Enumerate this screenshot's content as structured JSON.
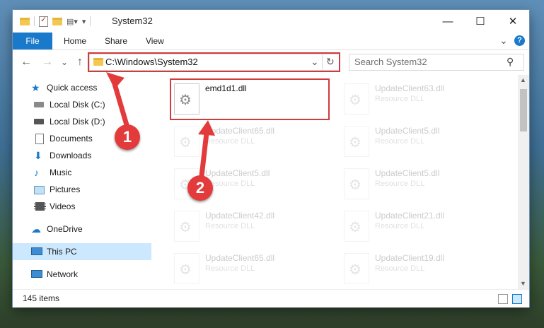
{
  "window": {
    "title": "System32",
    "controls": {
      "minimize": "—",
      "maximize": "☐",
      "close": "✕"
    }
  },
  "ribbon": {
    "tabs": [
      "File",
      "Home",
      "Share",
      "View"
    ],
    "help": "?",
    "expand_glyph": "⌄"
  },
  "address_bar": {
    "path": "C:\\Windows\\System32",
    "dropdown_glyph": "⌄",
    "refresh_glyph": "↻"
  },
  "search": {
    "placeholder": "Search System32",
    "icon": "search-icon"
  },
  "nav_buttons": {
    "back": "←",
    "forward": "→",
    "recent": "⌄",
    "up": "↑"
  },
  "nav_pane": {
    "items": [
      {
        "label": "Quick access",
        "icon": "star-icon",
        "pinned": false
      },
      {
        "label": "Local Disk (C:)",
        "icon": "drive-icon",
        "pinned": true
      },
      {
        "label": "Local Disk (D:)",
        "icon": "drive-icon",
        "pinned": true
      },
      {
        "label": "Documents",
        "icon": "documents-icon",
        "pinned": true
      },
      {
        "label": "Downloads",
        "icon": "download-icon",
        "pinned": true
      },
      {
        "label": "Music",
        "icon": "music-icon",
        "pinned": true
      },
      {
        "label": "Pictures",
        "icon": "pictures-icon",
        "pinned": true
      },
      {
        "label": "Videos",
        "icon": "videos-icon",
        "pinned": true
      },
      {
        "label": "OneDrive",
        "icon": "cloud-icon",
        "pinned": false
      },
      {
        "label": "This PC",
        "icon": "pc-icon",
        "pinned": false,
        "selected": true
      },
      {
        "label": "Network",
        "icon": "network-icon",
        "pinned": false
      }
    ],
    "pin_glyph": "📌"
  },
  "files": [
    {
      "name": "emd1d1.dll",
      "type": "",
      "highlighted": true
    },
    {
      "name": "UpdateClient63.dll",
      "type": "Resource DLL"
    },
    {
      "name": "UpdateClient65.dll",
      "type": "Resource DLL"
    },
    {
      "name": "UpdateClient5.dll",
      "type": "Resource DLL"
    },
    {
      "name": "UpdateClient5.dll",
      "type": "Resource DLL"
    },
    {
      "name": "UpdateClient5.dll",
      "type": "Resource DLL"
    },
    {
      "name": "UpdateClient42.dll",
      "type": "Resource DLL"
    },
    {
      "name": "UpdateClient21.dll",
      "type": "Resource DLL"
    },
    {
      "name": "UpdateClient65.dll",
      "type": "Resource DLL"
    },
    {
      "name": "UpdateClient19.dll",
      "type": "Resource DLL"
    }
  ],
  "status_bar": {
    "item_count": "145 items"
  },
  "annotations": {
    "step1": "1",
    "step2": "2"
  },
  "colors": {
    "accent": "#1979ca",
    "highlight": "#d23b3b",
    "selected_bg": "#cce8ff"
  }
}
